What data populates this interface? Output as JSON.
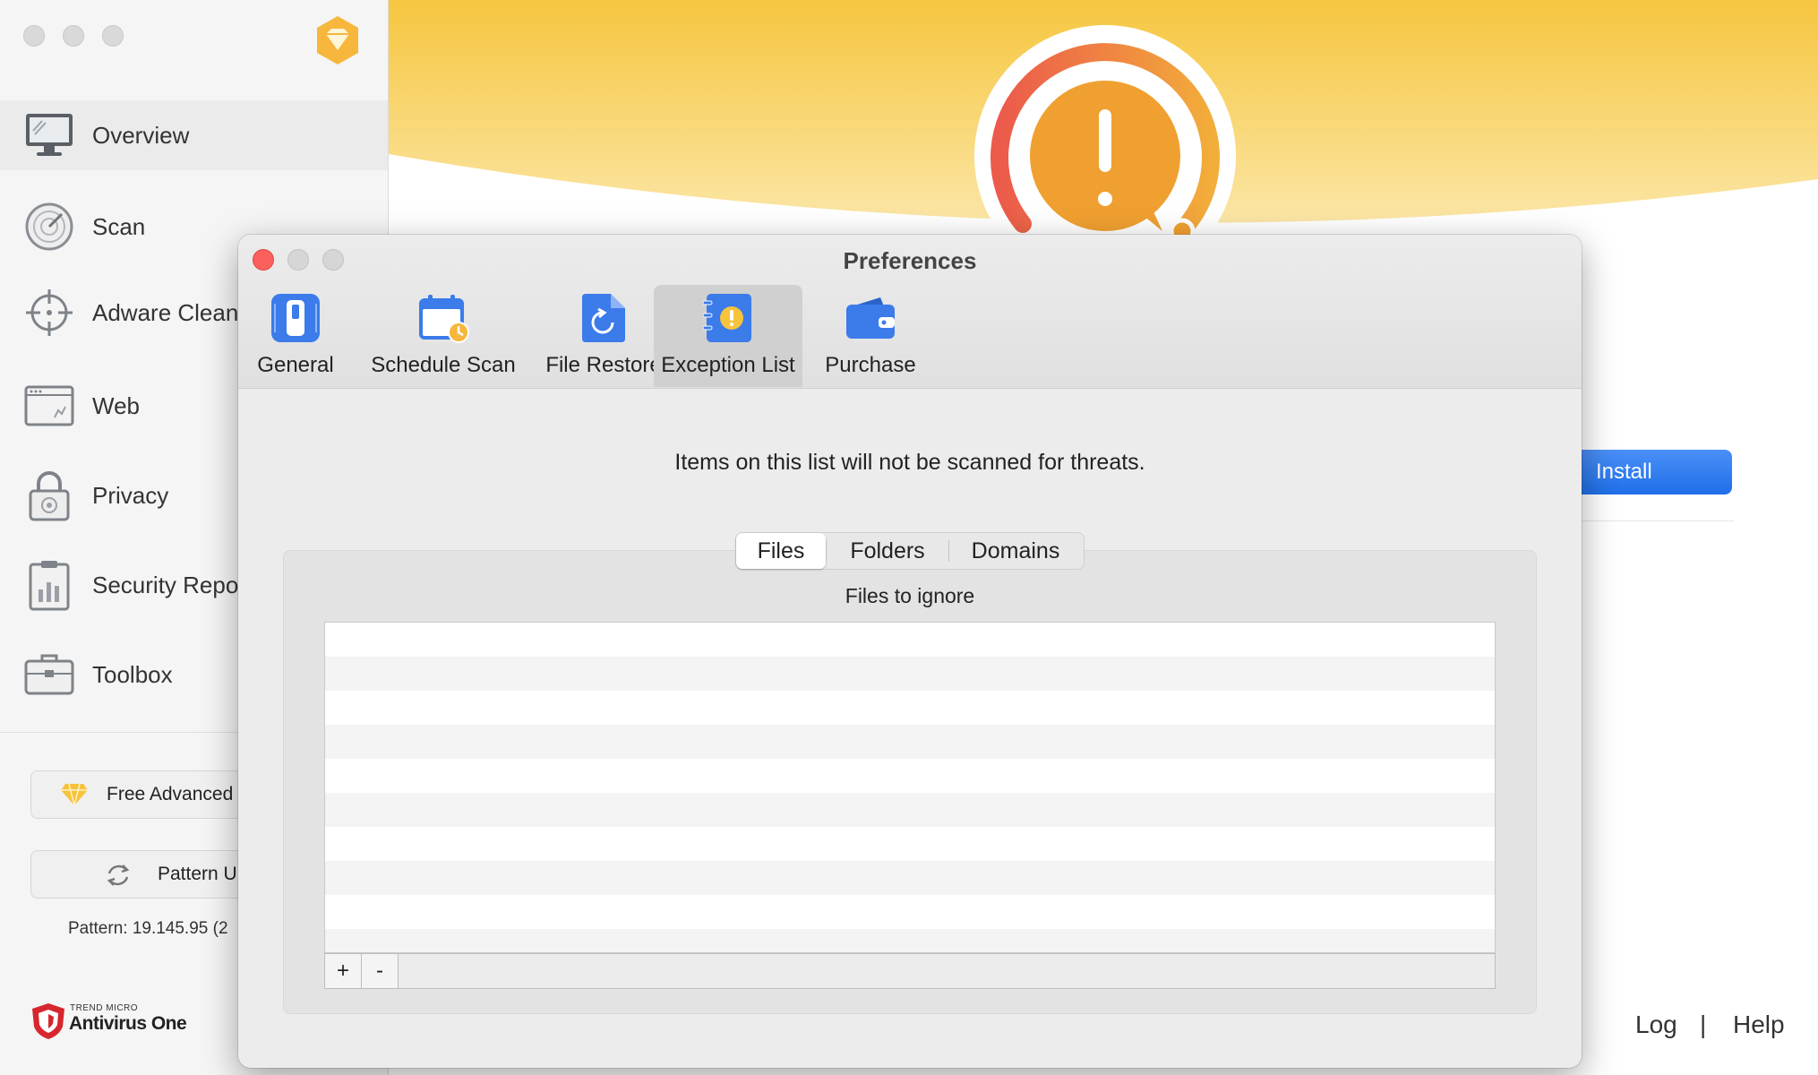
{
  "sidebar": {
    "items": [
      {
        "label": "Overview",
        "icon": "monitor-icon"
      },
      {
        "label": "Scan",
        "icon": "radar-icon"
      },
      {
        "label": "Adware Clean",
        "icon": "crosshair-icon"
      },
      {
        "label": "Web",
        "icon": "browser-icon"
      },
      {
        "label": "Privacy",
        "icon": "lock-icon"
      },
      {
        "label": "Security Repo",
        "icon": "report-icon"
      },
      {
        "label": "Toolbox",
        "icon": "toolbox-icon"
      }
    ],
    "free_advanced_label": "Free Advanced",
    "pattern_update_label": "Pattern U",
    "pattern_text": "Pattern: 19.145.95 (2",
    "brand_small": "TREND MICRO",
    "brand_name": "Antivirus One"
  },
  "main": {
    "install_label": "Install",
    "log_label": "Log",
    "separator": "|",
    "help_label": "Help"
  },
  "preferences": {
    "title": "Preferences",
    "tabs": [
      {
        "label": "General",
        "icon": "switch-icon"
      },
      {
        "label": "Schedule Scan",
        "icon": "calendar-icon"
      },
      {
        "label": "File Restore",
        "icon": "restore-icon"
      },
      {
        "label": "Exception List",
        "icon": "exception-list-icon"
      },
      {
        "label": "Purchase",
        "icon": "wallet-icon"
      }
    ],
    "selected_tab": "Exception List",
    "description": "Items on this list will not be scanned for threats.",
    "segments": [
      "Files",
      "Folders",
      "Domains"
    ],
    "selected_segment": "Files",
    "list_heading": "Files to ignore",
    "add_label": "+",
    "remove_label": "-"
  },
  "colors": {
    "accent_blue": "#2a76ee",
    "warning_orange": "#f0a030",
    "close_red": "#fc605c",
    "hero_yellow": "#f7c948"
  }
}
